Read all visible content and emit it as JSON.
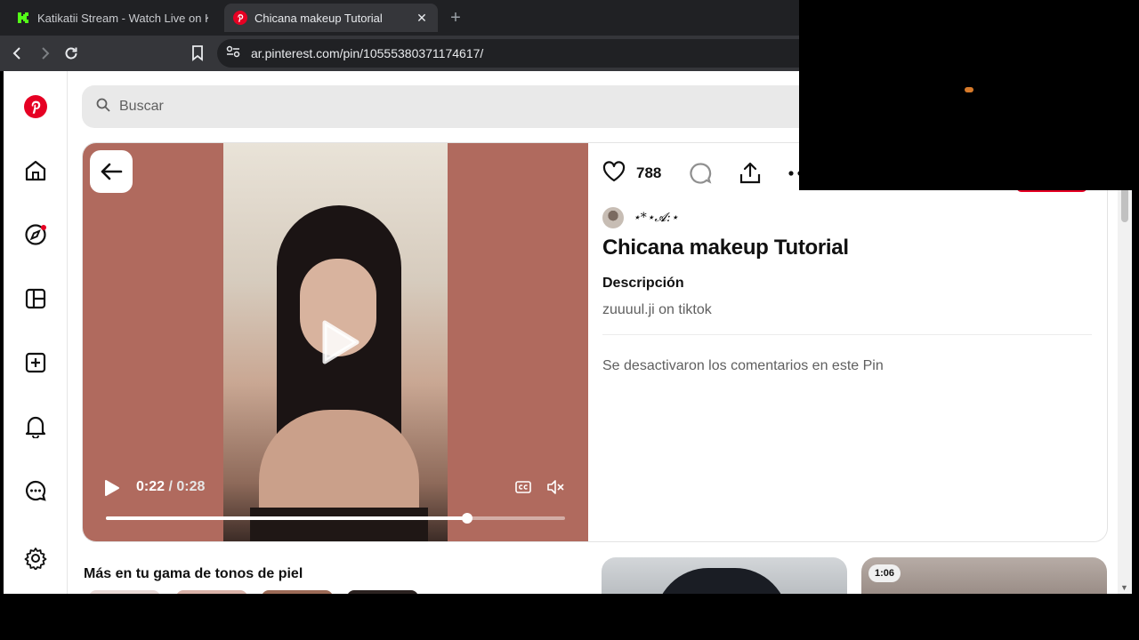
{
  "browser": {
    "tabs": [
      {
        "label": "Katikatii Stream - Watch Live on Kick",
        "active": false,
        "icon": "kick-logo-icon"
      },
      {
        "label": "Chicana makeup Tutorial",
        "active": true,
        "icon": "pinterest-logo-icon"
      }
    ],
    "close_symbol": "✕",
    "new_tab_symbol": "+",
    "url": "ar.pinterest.com/pin/10555380371174617/"
  },
  "search": {
    "placeholder": "Buscar"
  },
  "video": {
    "current_time": "0:22",
    "duration": "/ 0:28",
    "progress_fraction": 0.786
  },
  "pin": {
    "like_count": "788",
    "author": "⋆*⋆𝓐:⋆",
    "title": "Chicana makeup Tutorial",
    "description_heading": "Descripción",
    "description": "zuuuul.ji on tiktok",
    "comments_disabled": "Se desactivaron los comentarios en este Pin"
  },
  "more": {
    "heading": "Más en tu gama de tonos de piel",
    "duration_badge": "1:06"
  },
  "colors": {
    "brand": "#e60023",
    "video_bg": "#b06a5e"
  }
}
